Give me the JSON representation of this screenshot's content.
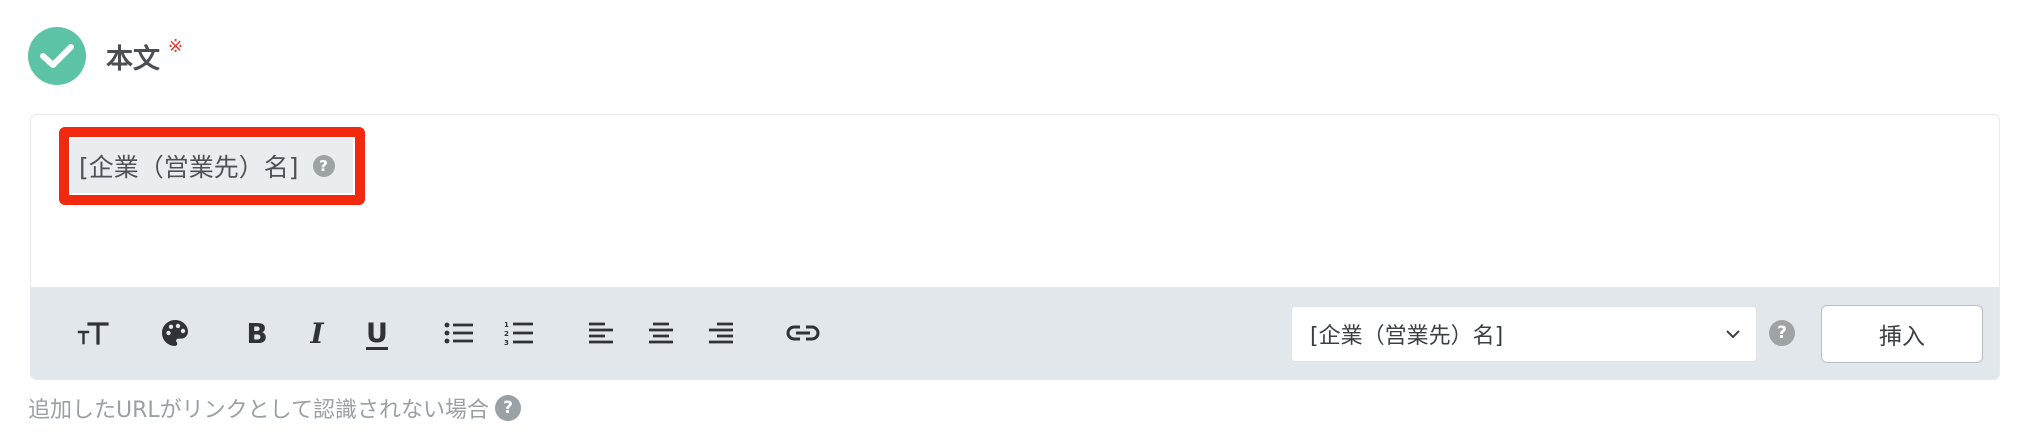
{
  "section": {
    "title": "本文",
    "required_mark": "※",
    "status_icon": "check-icon",
    "status_color": "#5cc3a7"
  },
  "editor": {
    "token_text": "[企業（営業先）名]",
    "token_help": "?",
    "highlight_color": "#f2280f"
  },
  "toolbar": {
    "icons": [
      "text-size-icon",
      "palette-icon",
      "bold-icon",
      "italic-icon",
      "underline-icon",
      "bullet-list-icon",
      "numbered-list-icon",
      "align-left-icon",
      "align-center-icon",
      "align-right-icon",
      "link-icon"
    ],
    "bold_label": "B",
    "italic_label": "I",
    "underline_label": "U",
    "variable_select_value": "[企業（営業先）名]",
    "help": "?",
    "insert_label": "挿入"
  },
  "footer": {
    "help_link_text": "追加したURLがリンクとして認識されない場合",
    "help_icon": "?"
  }
}
